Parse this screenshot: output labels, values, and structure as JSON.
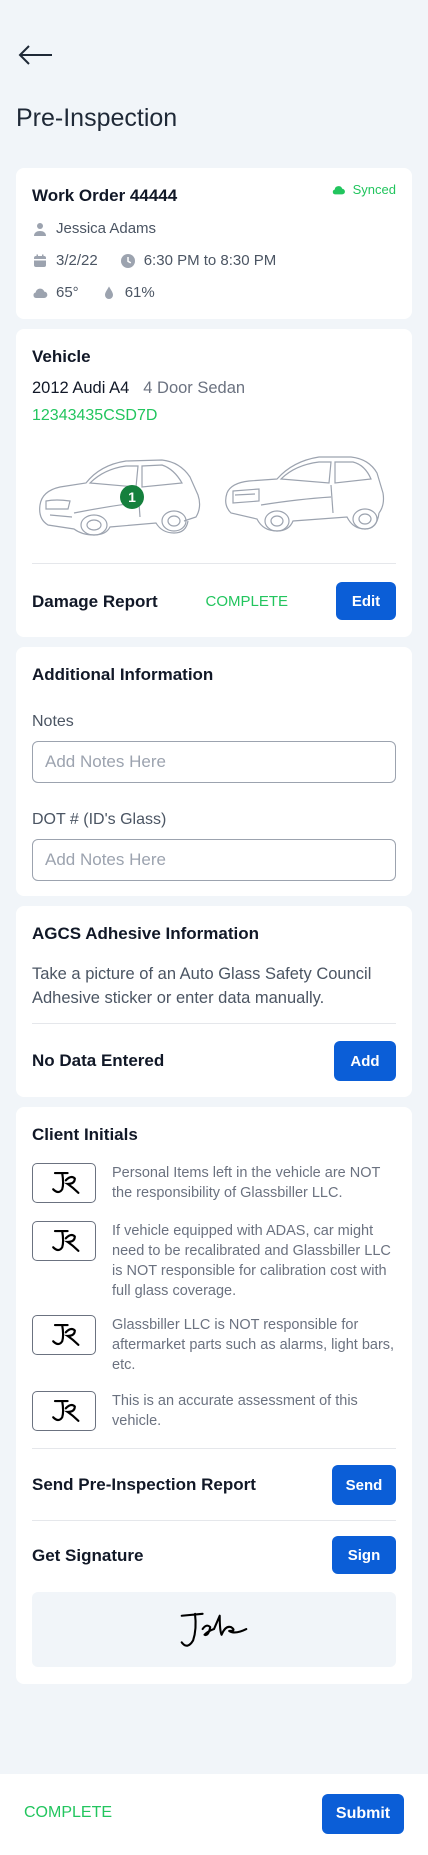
{
  "header": {
    "title": "Pre-Inspection"
  },
  "work_order": {
    "title": "Work Order 44444",
    "sync_status": "Synced",
    "customer": "Jessica Adams",
    "date": "3/2/22",
    "time": "6:30 PM to 8:30 PM",
    "temperature": "65°",
    "humidity": "61%",
    "icons": {
      "customer": "person-icon",
      "date": "calendar-icon",
      "time": "clock-icon",
      "temperature": "cloud-icon",
      "humidity": "droplet-icon",
      "sync": "cloud-icon"
    }
  },
  "vehicle": {
    "heading": "Vehicle",
    "model": "2012 Audi A4",
    "body_style": "4 Door Sedan",
    "vin": "12343435CSD7D",
    "damage_marker": "1",
    "damage_report_label": "Damage Report",
    "damage_status": "COMPLETE",
    "edit_label": "Edit"
  },
  "additional_info": {
    "heading": "Additional Information",
    "notes_label": "Notes",
    "notes_placeholder": "Add Notes Here",
    "dot_label": "DOT # (ID's Glass)",
    "dot_placeholder": "Add Notes Here"
  },
  "adhesive": {
    "heading": "AGCS Adhesive Information",
    "description": "Take a picture of an Auto Glass Safety Council Adhesive sticker or enter data manually.",
    "status": "No Data Entered",
    "add_label": "Add"
  },
  "client_initials": {
    "heading": "Client Initials",
    "items": [
      {
        "text": "Personal Items left in the vehicle are NOT the responsibility of Glassbiller LLC."
      },
      {
        "text": "If vehicle equipped with ADAS, car might need to be recalibrated and Glassbiller LLC is NOT responsible for calibration cost with full glass coverage."
      },
      {
        "text": "Glassbiller LLC is NOT responsible for aftermarket parts such as alarms, light bars, etc."
      },
      {
        "text": "This is an accurate assessment of this vehicle."
      }
    ],
    "send_report_label": "Send Pre-Inspection Report",
    "send_label": "Send",
    "signature_label": "Get Signature",
    "sign_label": "Sign"
  },
  "footer": {
    "status": "COMPLETE",
    "submit_label": "Submit"
  },
  "colors": {
    "accent": "#0b5ed7",
    "success": "#22c55e",
    "background": "#f1f5f9",
    "marker": "#15803d"
  }
}
